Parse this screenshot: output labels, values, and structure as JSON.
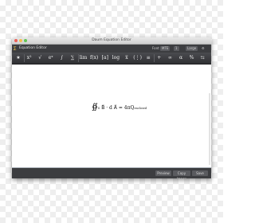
{
  "window": {
    "title": "Daum Equation Editor"
  },
  "toolbar": {
    "logo": "∑",
    "app_name": "Equation Editor",
    "font_label": "Font",
    "font_value": "MTE",
    "zoom_value": "1",
    "view_value": "Large"
  },
  "palette": [
    {
      "glyph": "★",
      "icon": "favorite-icon"
    },
    {
      "glyph": "x²",
      "icon": "superscript-icon"
    },
    {
      "glyph": "√",
      "icon": "root-icon"
    },
    {
      "glyph": "eˣ",
      "icon": "exponent-icon"
    },
    {
      "glyph": "∫",
      "icon": "integral-icon"
    },
    {
      "glyph": "∑",
      "icon": "sum-icon"
    },
    {
      "glyph": "lim",
      "icon": "limit-icon"
    },
    {
      "glyph": "f(x)",
      "icon": "function-icon"
    },
    {
      "glyph": "[a]",
      "icon": "bracket-icon"
    },
    {
      "glyph": "log",
      "icon": "log-icon"
    },
    {
      "glyph": "x̅",
      "icon": "accent-icon"
    },
    {
      "glyph": "(⋮)",
      "icon": "matrix-icon"
    },
    {
      "glyph": "≡",
      "icon": "array-icon"
    },
    {
      "glyph": "+",
      "icon": "operator-icon"
    },
    {
      "glyph": "∞",
      "icon": "symbol-icon"
    },
    {
      "glyph": "α",
      "icon": "greek-icon"
    },
    {
      "glyph": "%",
      "icon": "units-icon"
    },
    {
      "glyph": "⇆",
      "icon": "arrows-icon"
    }
  ],
  "equation": {
    "integral": "∯",
    "subscript": "S",
    "body": "B⃗ · d A⃗ = 4πQ",
    "enclosed": "enclosed"
  },
  "source_text": "{ \\oint _{ S }^{ }{ \\vec { B } \\cdot d\\vec { A } =4\\pi { Q }_{ enclosed } }",
  "buttons": {
    "preview": "Preview",
    "copy_image": "Copy Image",
    "save": "Save"
  }
}
